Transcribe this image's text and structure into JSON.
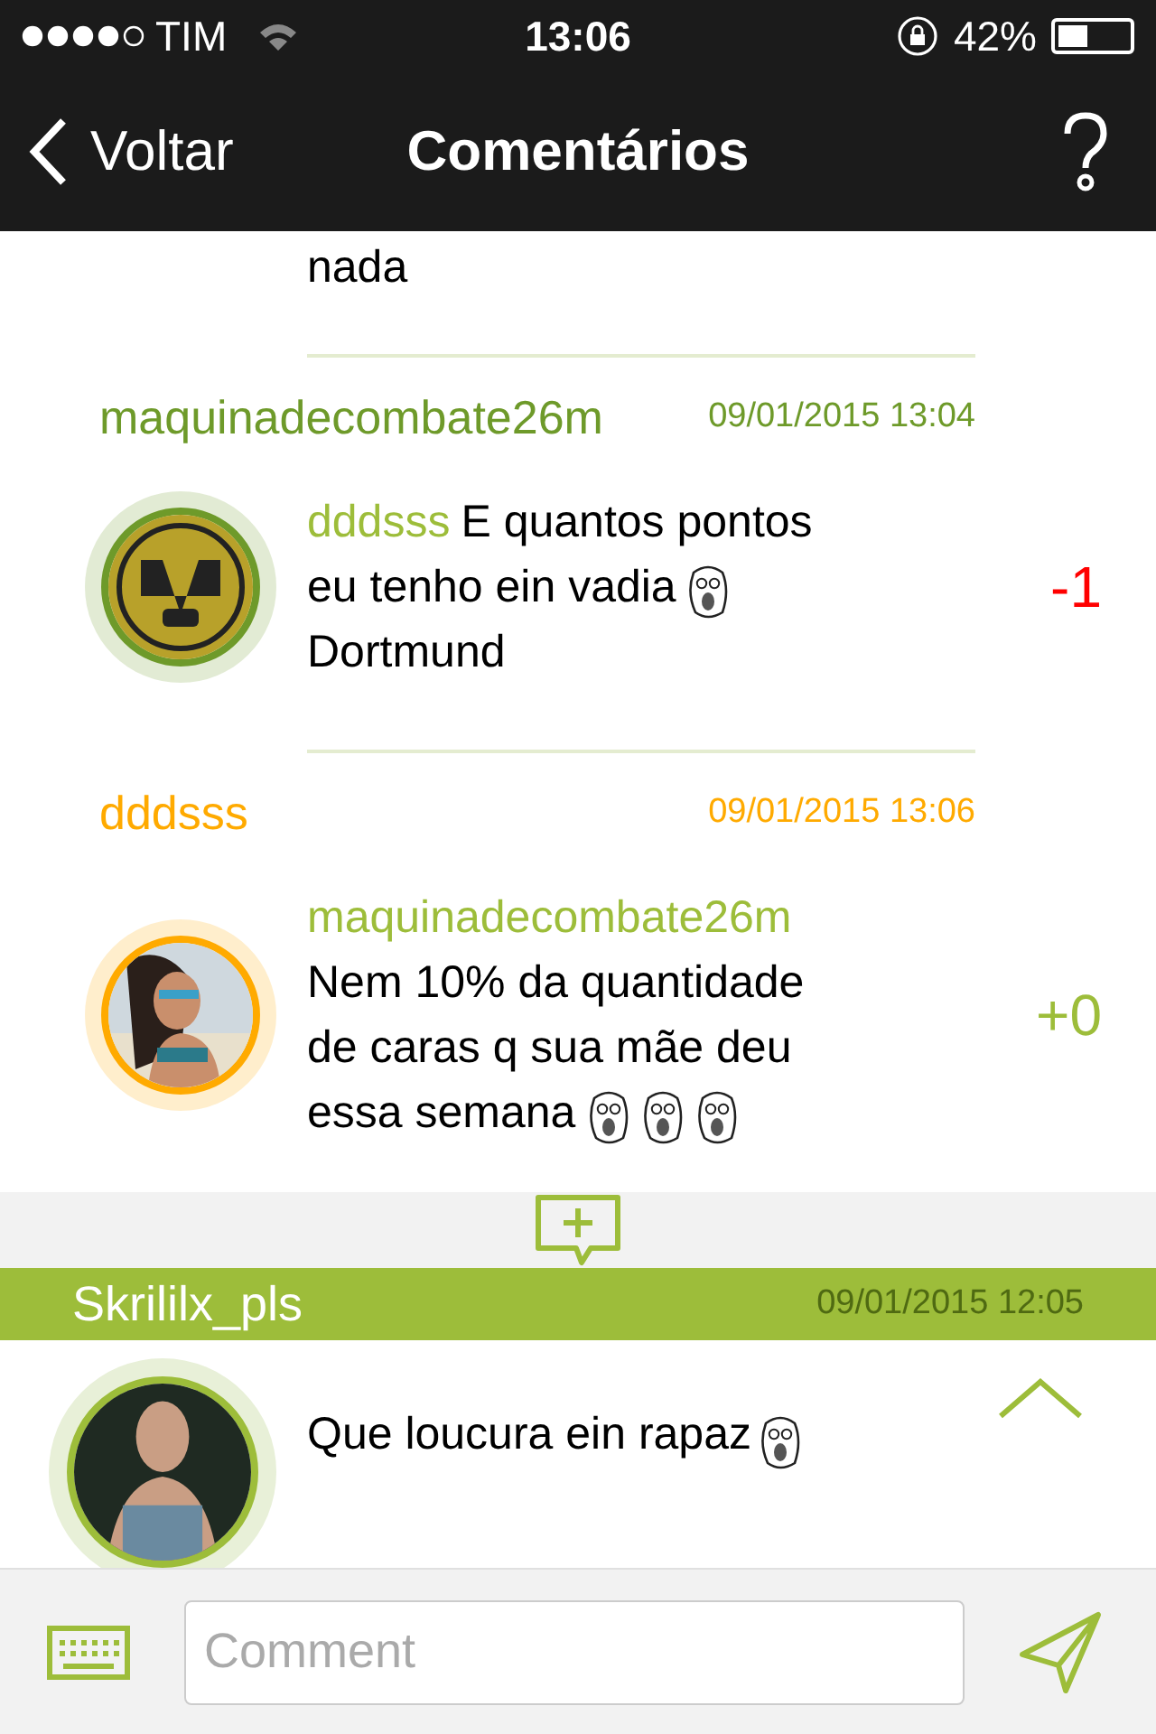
{
  "status_bar": {
    "carrier": "TIM",
    "time": "13:06",
    "battery": "42%"
  },
  "nav": {
    "back": "Voltar",
    "title": "Comentários"
  },
  "thread_tail": "nada",
  "replies": [
    {
      "author": "maquinadecombate26m",
      "color": "#6e9a2a",
      "date": "09/01/2015 13:04",
      "avatar": {
        "kind": "badge"
      },
      "lines": [
        [
          {
            "kind": "mention",
            "text": "dddsss"
          },
          {
            "kind": "text",
            "text": "E quantos pontos"
          }
        ],
        [
          {
            "kind": "text",
            "text": "eu tenho ein vadia"
          },
          {
            "kind": "emote"
          }
        ],
        [
          {
            "kind": "text",
            "text": "Dortmund"
          }
        ]
      ],
      "score": {
        "text": "-1",
        "color": "#ff0000"
      }
    },
    {
      "author": "dddsss",
      "color": "#ffaa00",
      "date": "09/01/2015 13:06",
      "avatar": {
        "kind": "picture"
      },
      "lines": [
        [
          {
            "kind": "mention",
            "text": "maquinadecombate26m"
          }
        ],
        [
          {
            "kind": "text",
            "text": "Nem 10% da quantidade"
          }
        ],
        [
          {
            "kind": "text",
            "text": "de caras q sua mãe deu"
          }
        ],
        [
          {
            "kind": "text",
            "text": "essa semana"
          },
          {
            "kind": "emote"
          },
          {
            "kind": "emote"
          },
          {
            "kind": "emote"
          }
        ]
      ],
      "score": {
        "text": "+0",
        "color": "#9dbd3a"
      }
    }
  ],
  "comment": {
    "author": "Skrililx_pls",
    "date": "09/01/2015 12:05",
    "text": "Que loucura ein rapaz"
  },
  "composer": {
    "placeholder": "Comment"
  }
}
